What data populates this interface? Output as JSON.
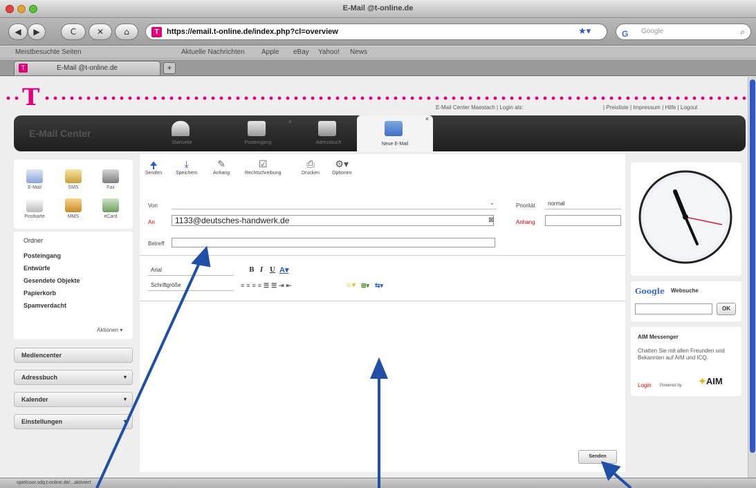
{
  "browser": {
    "window_title": "E-Mail @t-online.de",
    "url": "https://email.t-online.de/index.php?cl=overview",
    "search_placeholder": "Google",
    "bookmarks": [
      "Meistbesuchte Seiten",
      "Aktuelle Nachrichten",
      "Apple",
      "eBay",
      "Yahoo!",
      "News"
    ],
    "tab_title": "E-Mail @t-online.de",
    "new_tab_label": "+",
    "back_label": "◀",
    "forward_label": "▶",
    "reload_label": "C",
    "stop_label": "✕",
    "home_label": "⌂",
    "status_text": "spielcoor.sdq.t-online.de/...aktiviert"
  },
  "header": {
    "logo_text": "T",
    "top_info": "E-Mail Center Maestach | Login als:",
    "top_links": "| Preisliste | Impressum | Hilfe | Logout"
  },
  "nav": {
    "brand": "E-Mail Center",
    "tabs": [
      {
        "label": "Startseite",
        "icon": "house-icon"
      },
      {
        "label": "Posteingang",
        "icon": "inbox-icon"
      },
      {
        "label": "Adressbuch",
        "icon": "addressbook-icon"
      },
      {
        "label": "Neue E-Mail",
        "icon": "new-mail-icon"
      }
    ],
    "close_label": "×"
  },
  "left": {
    "quick_items": [
      "E-Mail",
      "SMS",
      "Fax",
      "Postkarte",
      "MMS",
      "eCard"
    ],
    "folders_header": "Ordner",
    "folders": [
      "Posteingang",
      "Entwürfe",
      "Gesendete Objekte",
      "Papierkorb",
      "Spamverdacht"
    ],
    "actions_label": "Aktionen ▾",
    "sections": [
      "Mediencenter",
      "Adressbuch",
      "Kalender",
      "Einstellungen"
    ]
  },
  "compose": {
    "toolbar": [
      "Senden",
      "Speichern",
      "Anhang",
      "Rechtschreibung",
      "Drucken",
      "Optionen"
    ],
    "from_label": "Von",
    "from_value": "",
    "to_label": "An",
    "to_value": "1133@deutsches-handwerk.de",
    "subject_label": "Betreff",
    "subject_value": "",
    "priority_label": "Priorität",
    "priority_value": "normal",
    "attachment_label": "Anhang",
    "font_value": "Arial",
    "size_value": "Schriftgröße",
    "send_button": "Senden"
  },
  "widgets": {
    "google_logo": "Google",
    "websuche_label": "Websuche",
    "ok_label": "OK",
    "aim_title": "AIM Messenger",
    "aim_text": "Chatten Sie mit allen Freunden und Bekannten auf AIM und ICQ.",
    "aim_login": "Login",
    "aim_powered": "Powered by",
    "aim_logo": "AIM"
  },
  "colors": {
    "brand_magenta": "#e2007a",
    "arrow_blue": "#1f4fa6"
  }
}
